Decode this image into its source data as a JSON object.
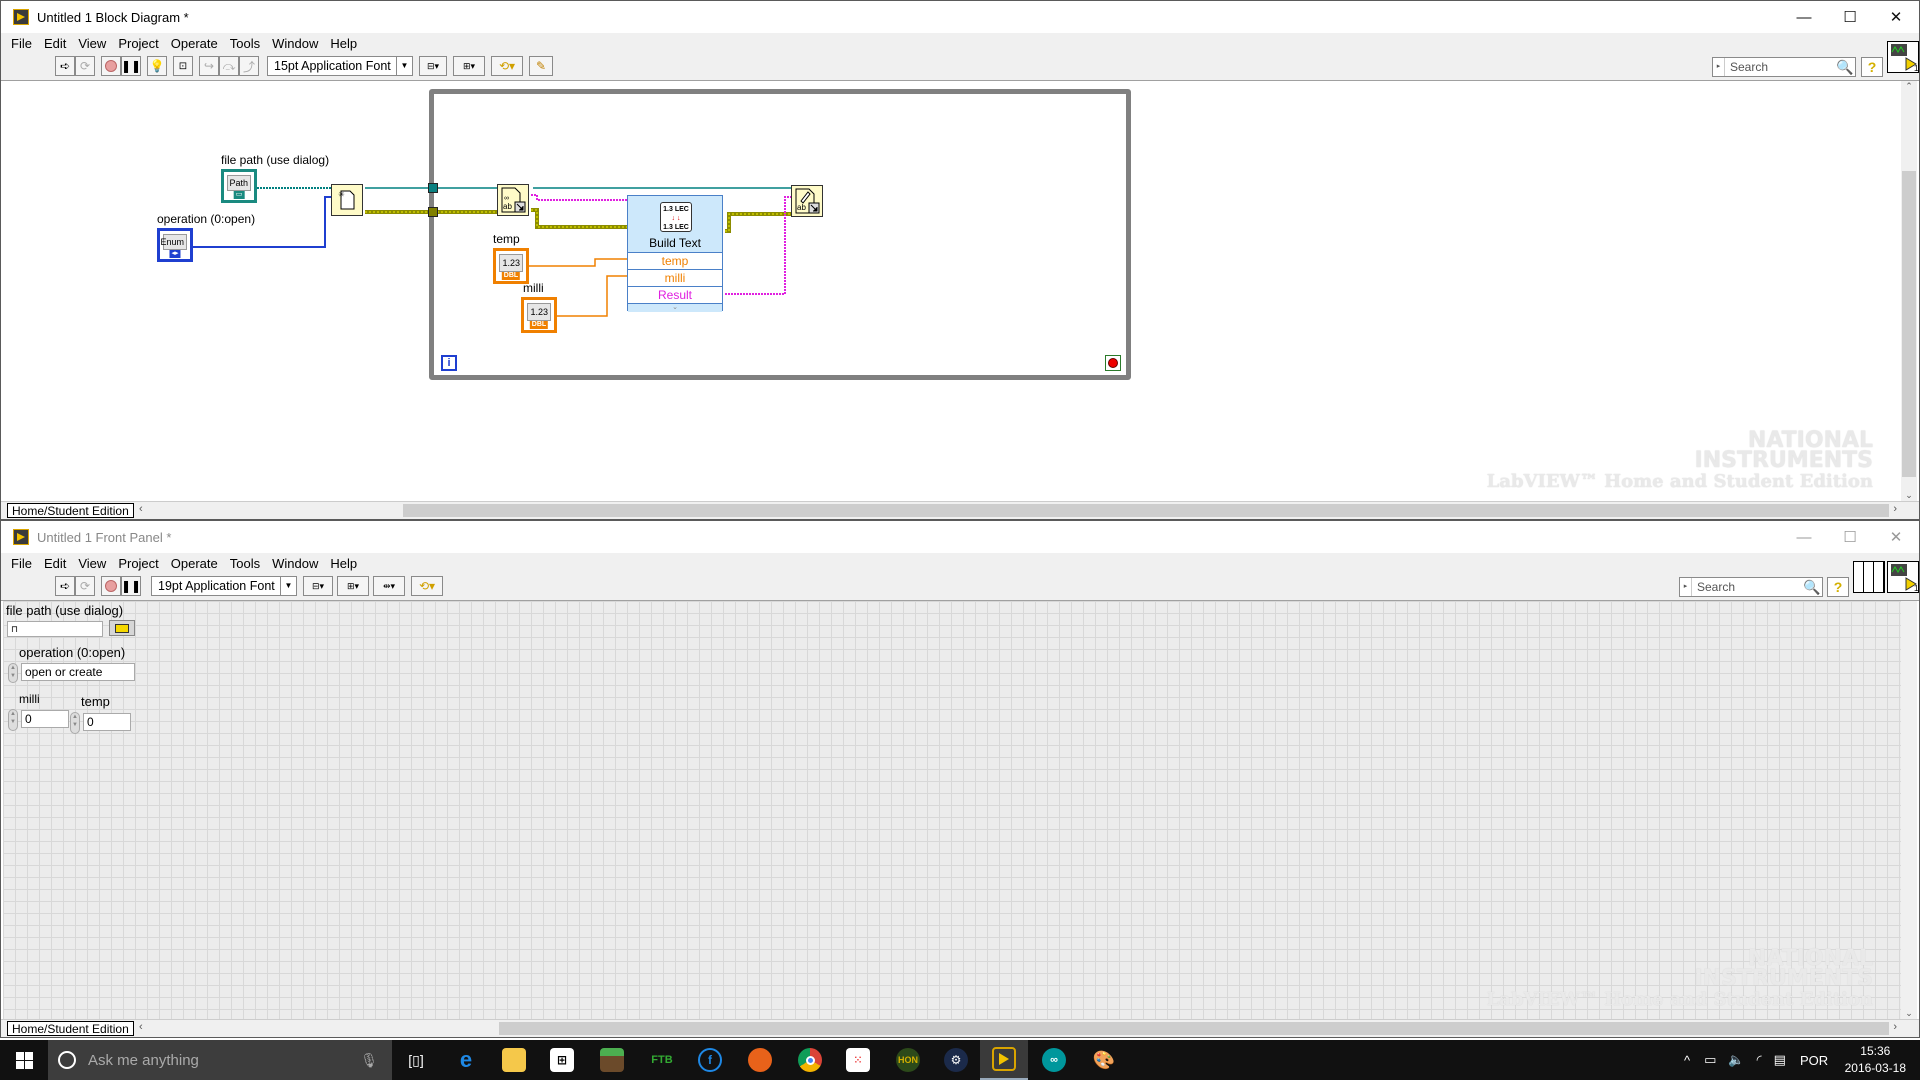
{
  "block_diagram": {
    "title": "Untitled 1 Block Diagram *",
    "window_buttons": {
      "minimize": "—",
      "maximize": "☐",
      "close": "✕"
    },
    "menu": [
      "File",
      "Edit",
      "View",
      "Project",
      "Operate",
      "Tools",
      "Window",
      "Help"
    ],
    "toolbar": {
      "font": "15pt Application Font",
      "search_placeholder": "Search",
      "help": "?"
    },
    "context": "Home/Student Edition",
    "nodes": {
      "file_path_label": "file path (use dialog)",
      "file_path_terminal": "Path",
      "operation_label": "operation (0:open)",
      "operation_terminal": "Enum",
      "temp_label": "temp",
      "milli_label": "milli",
      "numeric_text": "1.23",
      "numeric_type": "DBL",
      "build_text": {
        "name": "Build Text",
        "icon_top": "1.3 LEC",
        "icon_bottom": "1.3 LEC",
        "inputs": [
          "temp",
          "milli"
        ],
        "output": "Result",
        "colors": {
          "input": "#f08000",
          "output": "#e020e0"
        }
      },
      "iteration": "i"
    },
    "watermark": {
      "line1": "NATIONAL",
      "line2": "INSTRUMENTS",
      "line3": "LabVIEW™ Home and Student Edition"
    }
  },
  "front_panel": {
    "title": "Untitled 1 Front Panel *",
    "window_buttons": {
      "minimize": "—",
      "maximize": "☐",
      "close": "✕"
    },
    "menu": [
      "File",
      "Edit",
      "View",
      "Project",
      "Operate",
      "Tools",
      "Window",
      "Help"
    ],
    "toolbar": {
      "font": "19pt Application Font",
      "search_placeholder": "Search",
      "help": "?"
    },
    "context": "Home/Student Edition",
    "controls": {
      "file_path": {
        "label": "file path (use dialog)",
        "value": ""
      },
      "operation": {
        "label": "operation (0:open)",
        "value": "open or create"
      },
      "milli": {
        "label": "milli",
        "value": "0"
      },
      "temp": {
        "label": "temp",
        "value": "0"
      }
    },
    "watermark": {
      "line1": "NATIONAL",
      "line2": "INSTRUMENTS",
      "line3": "LabVIEW™ Home and Student Edition"
    }
  },
  "taskbar": {
    "search_placeholder": "Ask me anything",
    "apps": [
      "task-view",
      "edge",
      "file-explorer",
      "store",
      "minecraft",
      "ftb",
      "app-f",
      "firefox",
      "chrome",
      "app-grid",
      "hon",
      "steam",
      "labview",
      "arduino",
      "paint"
    ],
    "language": "POR",
    "time": "15:36",
    "date": "2016-03-18"
  },
  "colors": {
    "wire_path": "#008080",
    "wire_refnum": "#8c8c00",
    "wire_enum": "#1f3fd0",
    "wire_dbl": "#f08000",
    "wire_string": "#e020e0",
    "loop_border": "#808080"
  }
}
